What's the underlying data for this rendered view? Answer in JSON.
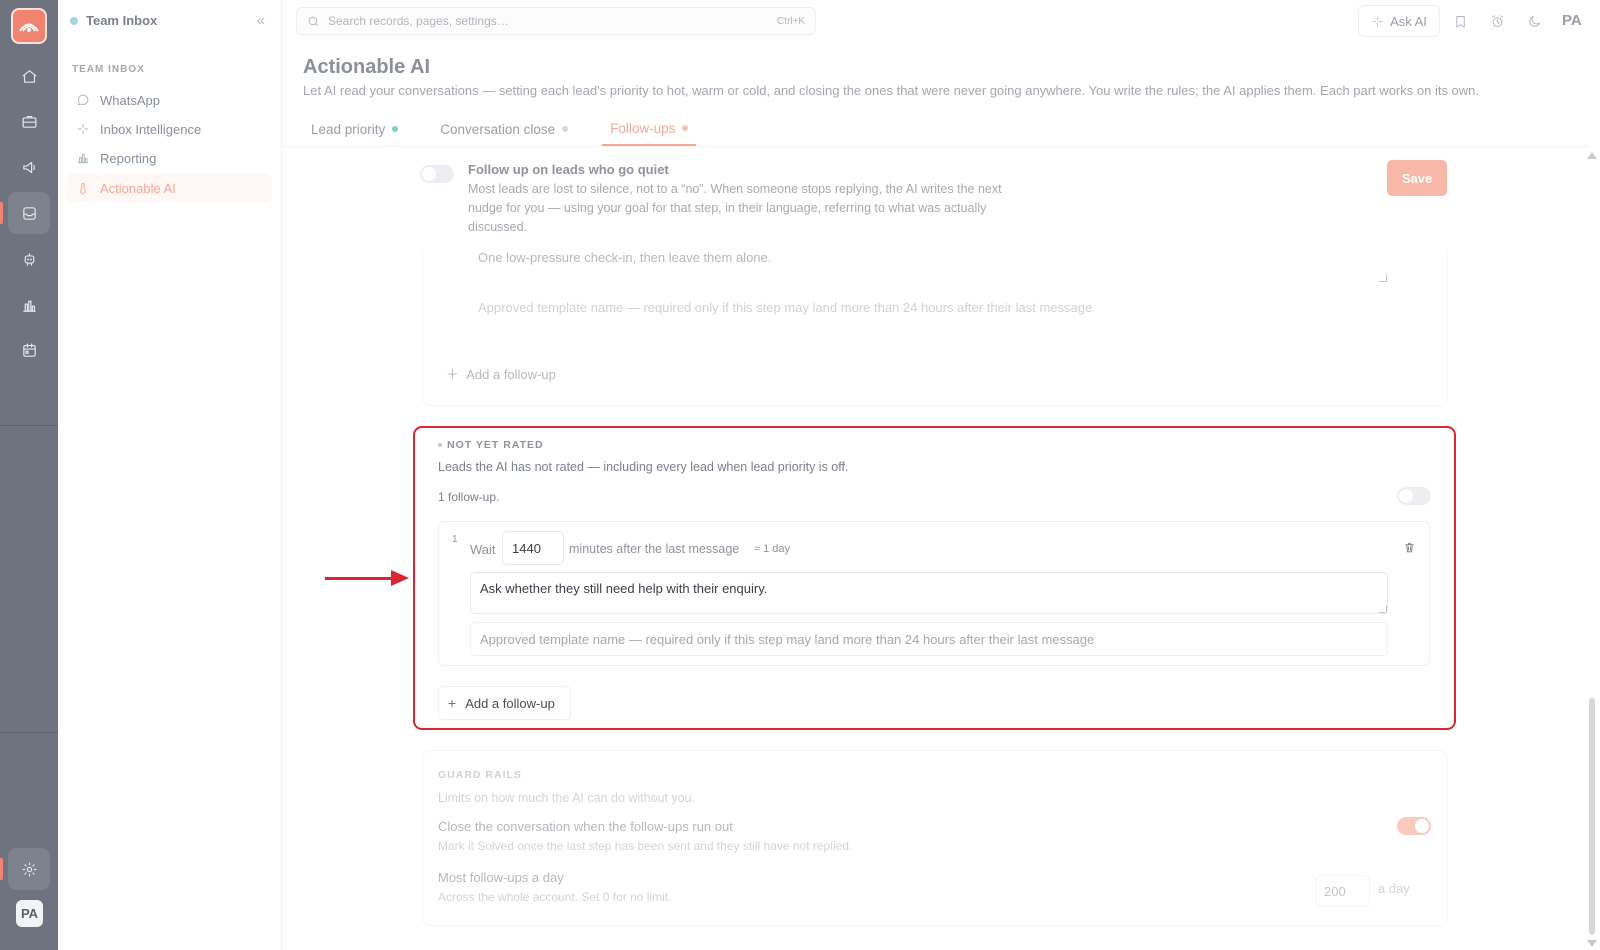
{
  "colors": {
    "accent": "#f08470",
    "highlight_border": "#d9262f",
    "rail_background": "#6e737f"
  },
  "rail": {
    "icons": [
      "home-icon",
      "briefcase-icon",
      "megaphone-icon",
      "inbox-icon",
      "robot-icon",
      "chart-icon",
      "calendar-icon",
      "settings-icon"
    ],
    "avatar_initials": "PA"
  },
  "sidebar": {
    "title": "Team Inbox",
    "section_label": "TEAM INBOX",
    "items": [
      {
        "label": "WhatsApp",
        "icon": "whatsapp-icon"
      },
      {
        "label": "Inbox Intelligence",
        "icon": "sparkle-icon"
      },
      {
        "label": "Reporting",
        "icon": "bar-chart-icon"
      },
      {
        "label": "Actionable AI",
        "icon": "thermometer-icon",
        "active": true
      }
    ]
  },
  "topbar": {
    "search_placeholder": "Search records, pages, settings…",
    "search_shortcut": "Ctrl+K",
    "ask_ai_label": "Ask AI",
    "user_initials": "PA"
  },
  "page": {
    "title": "Actionable AI",
    "description": "Let AI read your conversations — setting each lead's priority to hot, warm or cold, and closing the ones that were never going anywhere. You write the rules; the AI applies them. Each part works on its own.",
    "tabs": [
      {
        "label": "Lead priority",
        "dot_color": "#7fd1c0"
      },
      {
        "label": "Conversation close",
        "dot_color": "#d6d8dc"
      },
      {
        "label": "Follow-ups",
        "dot_color": "#f6c3b6",
        "active": true
      }
    ]
  },
  "followups": {
    "toggle_on": false,
    "title": "Follow up on leads who go quiet",
    "description": "Most leads are lost to silence, not to a “no”. When someone stops replying, the AI writes the next nudge for you — using your goal for that step, in their language, referring to what was actually discussed.",
    "save_label": "Save"
  },
  "previous_section": {
    "step_message": "One low-pressure check-in, then leave them alone.",
    "template_placeholder": "Approved template name — required only if this step may land more than 24 hours after their last message",
    "add_label": "Add a follow-up"
  },
  "not_yet_rated": {
    "label": "NOT YET RATED",
    "description": "Leads the AI has not rated — including every lead when lead priority is off.",
    "count_text": "1 follow-up.",
    "toggle_on": false,
    "steps": [
      {
        "number": "1",
        "wait_label": "Wait",
        "wait_minutes": "1440",
        "after_text": "minutes after the last message",
        "approx_text": "≈ 1 day",
        "message": "Ask whether they still need help with their enquiry.",
        "template_placeholder": "Approved template name — required only if this step may land more than 24 hours after their last message"
      }
    ],
    "add_label": "Add a follow-up"
  },
  "guard_rails": {
    "label": "GUARD RAILS",
    "description": "Limits on how much the AI can do without you.",
    "close_title": "Close the conversation when the follow-ups run out",
    "close_desc": "Mark it Solved once the last step has been sent and they still have not replied.",
    "close_toggle_on": true,
    "max_title": "Most follow-ups a day",
    "max_desc": "Across the whole account. Set 0 for no limit.",
    "max_value": "200",
    "max_unit": "a day"
  }
}
